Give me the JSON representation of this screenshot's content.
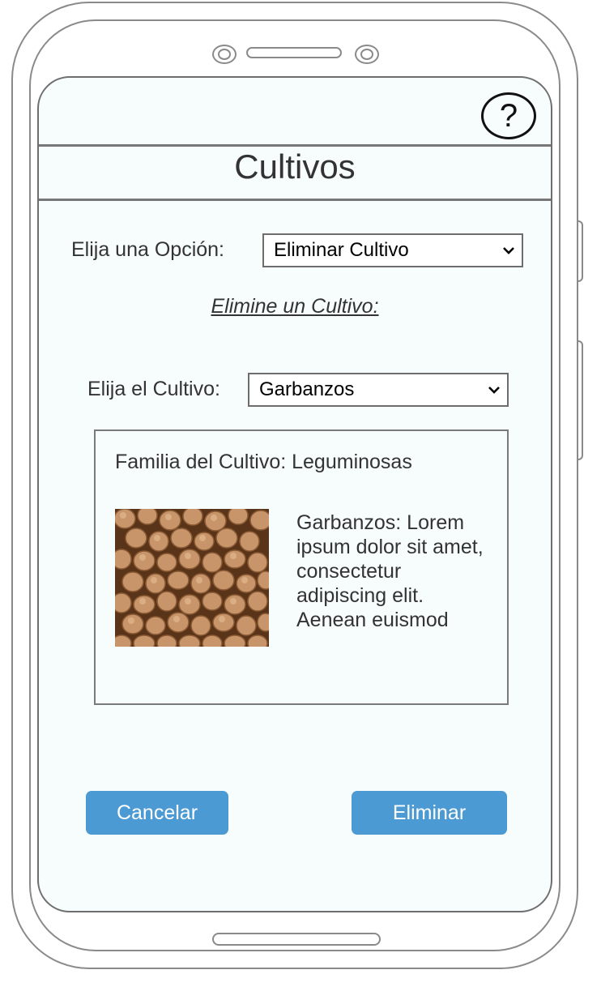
{
  "header": {
    "help_label": "?",
    "title": "Cultivos"
  },
  "form": {
    "option_label": "Elija una Opción:",
    "option_value": "Eliminar Cultivo",
    "section_heading": "Elimine un Cultivo:",
    "crop_label": "Elija el Cultivo:",
    "crop_value": "Garbanzos"
  },
  "card": {
    "family_text": "Familia del Cultivo: Leguminosas",
    "image_icon": "chickpeas-photo",
    "description": "Garbanzos: Lorem ipsum dolor sit amet, consectetur adipiscing elit. Aenean euismod"
  },
  "actions": {
    "cancel_label": "Cancelar",
    "delete_label": "Eliminar"
  },
  "colors": {
    "button": "#4b9ad3",
    "screen_background": "#f7fcfd"
  }
}
